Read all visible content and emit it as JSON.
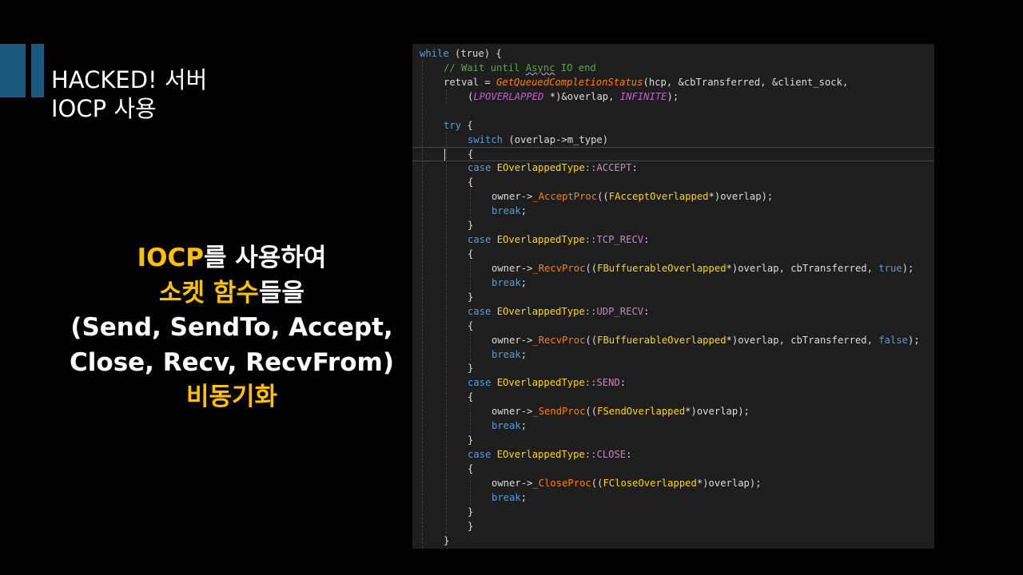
{
  "slide": {
    "title_lines": [
      "HACKED! 서버",
      "IOCP 사용"
    ],
    "body_lines": [
      [
        {
          "text": "IOCP",
          "hl": true
        },
        {
          "text": "를 사용하여",
          "hl": false
        }
      ],
      [
        {
          "text": "소켓 함수",
          "hl": true
        },
        {
          "text": "들을",
          "hl": false
        }
      ],
      [
        {
          "text": "(Send, SendTo, Accept,",
          "hl": false
        }
      ],
      [
        {
          "text": "Close, Recv, RecvFrom)",
          "hl": false
        }
      ],
      [
        {
          "text": "비동기화",
          "hl": true
        }
      ]
    ],
    "colors": {
      "background": "#000000",
      "accent": "#1a5a7e",
      "highlight": "#ffc000",
      "text": "#ffffff"
    }
  },
  "code": {
    "language": "cpp",
    "lines": [
      {
        "i": 0,
        "t": [
          [
            "kw",
            "while"
          ],
          [
            "p",
            " (true) {"
          ]
        ]
      },
      {
        "i": 1,
        "t": [
          [
            "cm",
            "// Wait until "
          ],
          [
            "cm squig",
            "Async"
          ],
          [
            "cm",
            " IO end"
          ]
        ]
      },
      {
        "i": 1,
        "t": [
          [
            "p",
            "retval = "
          ],
          [
            "fn",
            "GetQueuedCompletionStatus"
          ],
          [
            "p",
            "(hcp, &cbTransferred, &client_sock,"
          ]
        ]
      },
      {
        "i": 2,
        "t": [
          [
            "p",
            "("
          ],
          [
            "mac",
            "LPOVERLAPPED"
          ],
          [
            "p",
            " *)&overlap, "
          ],
          [
            "mac",
            "INFINITE"
          ],
          [
            "p",
            ");"
          ]
        ]
      },
      {
        "i": 1,
        "t": [
          [
            "p",
            ""
          ]
        ]
      },
      {
        "i": 1,
        "t": [
          [
            "kw",
            "try"
          ],
          [
            "p",
            " {"
          ]
        ]
      },
      {
        "i": 2,
        "t": [
          [
            "kw",
            "switch"
          ],
          [
            "p",
            " (overlap->m_type)"
          ]
        ]
      },
      {
        "i": 2,
        "t": [
          [
            "p",
            "{"
          ]
        ]
      },
      {
        "i": 2,
        "t": [
          [
            "kw",
            "case "
          ],
          [
            "type",
            "EOverlappedType"
          ],
          [
            "op",
            "::"
          ],
          [
            "enm",
            "ACCEPT"
          ],
          [
            "p",
            ":"
          ]
        ]
      },
      {
        "i": 2,
        "t": [
          [
            "p",
            "{"
          ]
        ]
      },
      {
        "i": 3,
        "t": [
          [
            "p",
            "owner->"
          ],
          [
            "mfn",
            "_AcceptProc"
          ],
          [
            "p",
            "(("
          ],
          [
            "type",
            "FAcceptOverlapped"
          ],
          [
            "p",
            "*)overlap);"
          ]
        ]
      },
      {
        "i": 3,
        "t": [
          [
            "kw",
            "break"
          ],
          [
            "p",
            ";"
          ]
        ]
      },
      {
        "i": 2,
        "t": [
          [
            "p",
            "}"
          ]
        ]
      },
      {
        "i": 2,
        "t": [
          [
            "kw",
            "case "
          ],
          [
            "type",
            "EOverlappedType"
          ],
          [
            "op",
            "::"
          ],
          [
            "enm",
            "TCP_RECV"
          ],
          [
            "p",
            ":"
          ]
        ]
      },
      {
        "i": 2,
        "t": [
          [
            "p",
            "{"
          ]
        ]
      },
      {
        "i": 3,
        "t": [
          [
            "p",
            "owner->"
          ],
          [
            "mfn",
            "_RecvProc"
          ],
          [
            "p",
            "(("
          ],
          [
            "type",
            "FBuffuerableOverlapped"
          ],
          [
            "p",
            "*)overlap, cbTransferred, "
          ],
          [
            "kw",
            "true"
          ],
          [
            "p",
            ");"
          ]
        ]
      },
      {
        "i": 3,
        "t": [
          [
            "kw",
            "break"
          ],
          [
            "p",
            ";"
          ]
        ]
      },
      {
        "i": 2,
        "t": [
          [
            "p",
            "}"
          ]
        ]
      },
      {
        "i": 2,
        "t": [
          [
            "kw",
            "case "
          ],
          [
            "type",
            "EOverlappedType"
          ],
          [
            "op",
            "::"
          ],
          [
            "enm",
            "UDP_RECV"
          ],
          [
            "p",
            ":"
          ]
        ]
      },
      {
        "i": 2,
        "t": [
          [
            "p",
            "{"
          ]
        ]
      },
      {
        "i": 3,
        "t": [
          [
            "p",
            "owner->"
          ],
          [
            "mfn",
            "_RecvProc"
          ],
          [
            "p",
            "(("
          ],
          [
            "type",
            "FBuffuerableOverlapped"
          ],
          [
            "p",
            "*)overlap, cbTransferred, "
          ],
          [
            "kw",
            "false"
          ],
          [
            "p",
            ");"
          ]
        ]
      },
      {
        "i": 3,
        "t": [
          [
            "kw",
            "break"
          ],
          [
            "p",
            ";"
          ]
        ]
      },
      {
        "i": 2,
        "t": [
          [
            "p",
            "}"
          ]
        ]
      },
      {
        "i": 2,
        "t": [
          [
            "kw",
            "case "
          ],
          [
            "type",
            "EOverlappedType"
          ],
          [
            "op",
            "::"
          ],
          [
            "enm",
            "SEND"
          ],
          [
            "p",
            ":"
          ]
        ]
      },
      {
        "i": 2,
        "t": [
          [
            "p",
            "{"
          ]
        ]
      },
      {
        "i": 3,
        "t": [
          [
            "p",
            "owner->"
          ],
          [
            "mfn",
            "_SendProc"
          ],
          [
            "p",
            "(("
          ],
          [
            "type",
            "FSendOverlapped"
          ],
          [
            "p",
            "*)overlap);"
          ]
        ]
      },
      {
        "i": 3,
        "t": [
          [
            "kw",
            "break"
          ],
          [
            "p",
            ";"
          ]
        ]
      },
      {
        "i": 2,
        "t": [
          [
            "p",
            "}"
          ]
        ]
      },
      {
        "i": 2,
        "t": [
          [
            "kw",
            "case "
          ],
          [
            "type",
            "EOverlappedType"
          ],
          [
            "op",
            "::"
          ],
          [
            "enm",
            "CLOSE"
          ],
          [
            "p",
            ":"
          ]
        ]
      },
      {
        "i": 2,
        "t": [
          [
            "p",
            "{"
          ]
        ]
      },
      {
        "i": 3,
        "t": [
          [
            "p",
            "owner->"
          ],
          [
            "mfn",
            "_CloseProc"
          ],
          [
            "p",
            "(("
          ],
          [
            "type",
            "FCloseOverlapped"
          ],
          [
            "p",
            "*)overlap);"
          ]
        ]
      },
      {
        "i": 3,
        "t": [
          [
            "kw",
            "break"
          ],
          [
            "p",
            ";"
          ]
        ]
      },
      {
        "i": 2,
        "t": [
          [
            "p",
            "}"
          ]
        ]
      },
      {
        "i": 2,
        "t": [
          [
            "p",
            "}"
          ]
        ]
      },
      {
        "i": 1,
        "t": [
          [
            "p",
            "}"
          ]
        ]
      }
    ]
  }
}
